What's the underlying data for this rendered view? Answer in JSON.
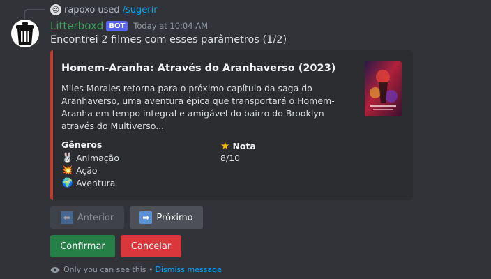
{
  "reply": {
    "user": "rapoxo",
    "used": "used",
    "command": "/sugerir"
  },
  "message": {
    "author": "Litterboxd",
    "badge": "BOT",
    "timestamp": "Today at 10:04 AM",
    "content": "Encontrei 2 filmes com esses parâmetros (1/2)"
  },
  "embed": {
    "accent_color": "#c0392b",
    "title": "Homem-Aranha: Através do Aranhaverso (2023)",
    "description": "Miles Morales retorna para o próximo capítulo da saga do Aranhaverso, uma aventura épica que transportará o Homem-Aranha em tempo integral e amigável do bairro do Brooklyn através do Multiverso...",
    "fields": {
      "genres_name": "Gêneros",
      "genres": [
        {
          "icon": "rabbit-emoji",
          "label": "Animação"
        },
        {
          "icon": "explosion-emoji",
          "label": "Ação"
        },
        {
          "icon": "globe-emoji",
          "label": "Aventura"
        }
      ],
      "rating_icon": "star-emoji",
      "rating_name": "Nota",
      "rating_value": "8/10"
    }
  },
  "buttons": {
    "prev": "Anterior",
    "next": "Próximo",
    "confirm": "Confirmar",
    "cancel": "Cancelar"
  },
  "ephemeral": {
    "text": "Only you can see this •",
    "dismiss": "Dismiss message"
  }
}
